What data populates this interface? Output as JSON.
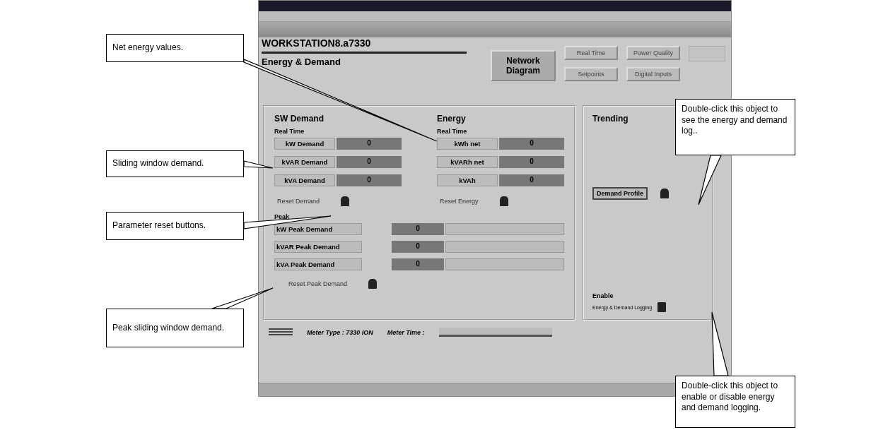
{
  "workstation": {
    "title": "WORKSTATION8.a7330",
    "subtitle": "Energy & Demand"
  },
  "nav_buttons": [
    {
      "label": "Network Diagram",
      "kind": "large",
      "disabled": false
    },
    {
      "label": "Real Time",
      "kind": "small",
      "disabled": false
    },
    {
      "label": "Power Quality",
      "kind": "small",
      "disabled": false
    },
    {
      "label": "Setpoints",
      "kind": "small",
      "disabled": false
    },
    {
      "label": "Digital Inputs",
      "kind": "small",
      "disabled": false
    }
  ],
  "sw_demand": {
    "heading": "SW Demand",
    "sublabel": "Real Time",
    "rows": [
      {
        "label": "kW Demand",
        "value": "0"
      },
      {
        "label": "kVAR Demand",
        "value": "0"
      },
      {
        "label": "kVA Demand",
        "value": "0"
      }
    ],
    "reset_label": "Reset Demand"
  },
  "energy": {
    "heading": "Energy",
    "sublabel": "Real Time",
    "rows": [
      {
        "label": "kWh net",
        "value": "0"
      },
      {
        "label": "kVARh net",
        "value": "0"
      },
      {
        "label": "kVAh",
        "value": "0"
      }
    ],
    "reset_label": "Reset Energy"
  },
  "peak": {
    "heading": "Peak",
    "rows": [
      {
        "label": "kW Peak Demand",
        "value": "0"
      },
      {
        "label": "kVAR Peak Demand",
        "value": "0"
      },
      {
        "label": "kVA Peak Demand",
        "value": "0"
      }
    ],
    "reset_label": "Reset Peak Demand"
  },
  "trending": {
    "heading": "Trending",
    "button": "Demand Profile",
    "enable_heading": "Enable",
    "enable_label": "Energy & Demand Logging"
  },
  "footer": {
    "meter_type": "Meter Type : 7330 ION",
    "meter_time_label": "Meter Time :"
  },
  "callouts": [
    {
      "text": "Net energy values."
    },
    {
      "text": "Sliding window demand."
    },
    {
      "text": "Parameter reset buttons."
    },
    {
      "text": "Peak sliding window demand."
    },
    {
      "text": "Double-click this object to see the energy and demand log.."
    },
    {
      "text": "Double-click this object to enable or disable energy and demand logging."
    }
  ]
}
